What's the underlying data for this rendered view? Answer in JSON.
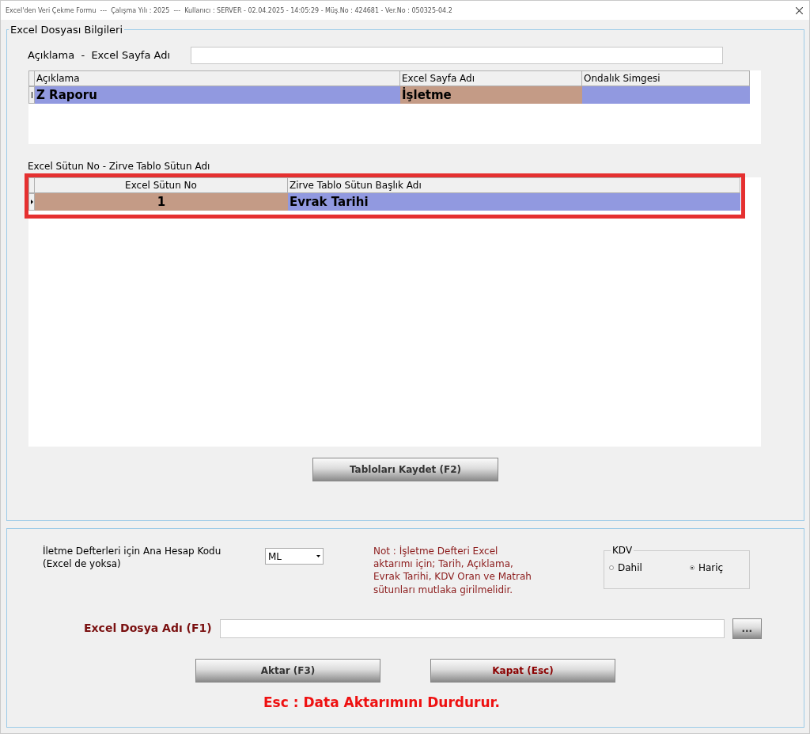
{
  "window": {
    "title": "Excel'den Veri Çekme Formu  ---  Çalışma Yılı : 2025  ---  Kullanıcı : SERVER - 02.04.2025 - 14:05:29 - Müş.No : 424681 - Ver.No : 050325-04.2"
  },
  "file_group": {
    "title": "Excel Dosyası Bilgileri",
    "sheet_field": {
      "label": "Açıklama  -  Excel Sayfa Adı"
    },
    "sheet_grid": {
      "columns": [
        "Açıklama",
        "Excel Sayfa Adı",
        "Ondalık Simgesi"
      ],
      "rows": [
        {
          "selected": true,
          "cells": [
            {
              "text": "Z Raporu",
              "color": "#9199e0"
            },
            {
              "text": "İşletme",
              "color": "#c49b86"
            },
            {
              "text": "",
              "color": "#9199e0"
            }
          ]
        }
      ]
    },
    "column_label": "Excel Sütun No - Zirve Tablo Sütun Adı",
    "column_grid": {
      "highlighted": true,
      "columns": [
        "Excel Sütun No",
        "Zirve Tablo Sütun Başlık Adı"
      ],
      "rows": [
        {
          "selected": true,
          "cells": [
            {
              "text": "1",
              "color": "#c49b86"
            },
            {
              "text": "Evrak Tarihi",
              "color": "#9199e0"
            }
          ]
        }
      ]
    },
    "save_button": "Tabloları Kaydet (F2)"
  },
  "import_group": {
    "account_label": "İletme Defterleri için Ana Hesap Kodu\n(Excel de yoksa)",
    "account_code": "ML",
    "note": "Not : İşletme Defteri Excel\naktarımı için; Tarih, Açıklama,\nEvrak Tarihi, KDV Oran ve Matrah\nsütunları mutlaka girilmelidir.",
    "kdv": {
      "title": "KDV",
      "options": [
        {
          "label": "Dahil",
          "selected": false
        },
        {
          "label": "Hariç",
          "selected": true
        }
      ]
    },
    "file_label": "Excel Dosya Adı (F1)",
    "browse_button": "...",
    "buttons": [
      {
        "label": "Aktar (F3)",
        "kind": "normal"
      },
      {
        "label": "Kapat (Esc)",
        "kind": "danger"
      }
    ],
    "hint": "Esc : Data Aktarımını Durdurur."
  }
}
